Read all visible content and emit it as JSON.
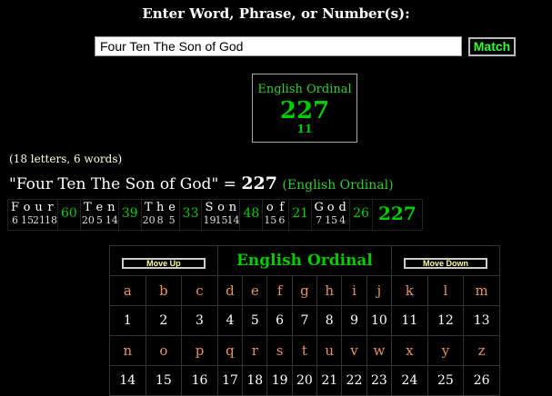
{
  "header": {
    "prompt": "Enter Word, Phrase, or Number(s):"
  },
  "search": {
    "value": "Four Ten The Son of God"
  },
  "match_button": {
    "label": "Match"
  },
  "cipher_box": {
    "name": "English Ordinal",
    "value": "227",
    "reduction": "11"
  },
  "counts": "(18 letters, 6 words)",
  "phrase": {
    "text": "\"Four Ten The Son of God\"",
    "equals": " = ",
    "total": "227",
    "cipher": "(English Ordinal)"
  },
  "breakdown": {
    "words": [
      {
        "letters": [
          {
            "l": "F",
            "n": "6"
          },
          {
            "l": "o",
            "n": "15"
          },
          {
            "l": "u",
            "n": "21"
          },
          {
            "l": "r",
            "n": "18"
          }
        ],
        "sum": "60"
      },
      {
        "letters": [
          {
            "l": "T",
            "n": "20"
          },
          {
            "l": "e",
            "n": "5"
          },
          {
            "l": "n",
            "n": "14"
          }
        ],
        "sum": "39"
      },
      {
        "letters": [
          {
            "l": "T",
            "n": "20"
          },
          {
            "l": "h",
            "n": "8"
          },
          {
            "l": "e",
            "n": "5"
          }
        ],
        "sum": "33"
      },
      {
        "letters": [
          {
            "l": "S",
            "n": "19"
          },
          {
            "l": "o",
            "n": "15"
          },
          {
            "l": "n",
            "n": "14"
          }
        ],
        "sum": "48"
      },
      {
        "letters": [
          {
            "l": "o",
            "n": "15"
          },
          {
            "l": "f",
            "n": "6"
          }
        ],
        "sum": "21"
      },
      {
        "letters": [
          {
            "l": "G",
            "n": "7"
          },
          {
            "l": "o",
            "n": "15"
          },
          {
            "l": "d",
            "n": "4"
          }
        ],
        "sum": "26"
      }
    ],
    "total": "227"
  },
  "grid": {
    "move_up": "Move Up",
    "title": "English Ordinal",
    "move_down": "Move Down",
    "row1_letters": [
      "a",
      "b",
      "c",
      "d",
      "e",
      "f",
      "g",
      "h",
      "i",
      "j",
      "k",
      "l",
      "m"
    ],
    "row1_numbers": [
      "1",
      "2",
      "3",
      "4",
      "5",
      "6",
      "7",
      "8",
      "9",
      "10",
      "11",
      "12",
      "13"
    ],
    "row2_letters": [
      "n",
      "o",
      "p",
      "q",
      "r",
      "s",
      "t",
      "u",
      "v",
      "w",
      "x",
      "y",
      "z"
    ],
    "row2_numbers": [
      "14",
      "15",
      "16",
      "17",
      "18",
      "19",
      "20",
      "21",
      "22",
      "23",
      "24",
      "25",
      "26"
    ]
  },
  "colors": {
    "green": "#00cc00",
    "orange_letters": "#e89060",
    "background": "#000000"
  }
}
